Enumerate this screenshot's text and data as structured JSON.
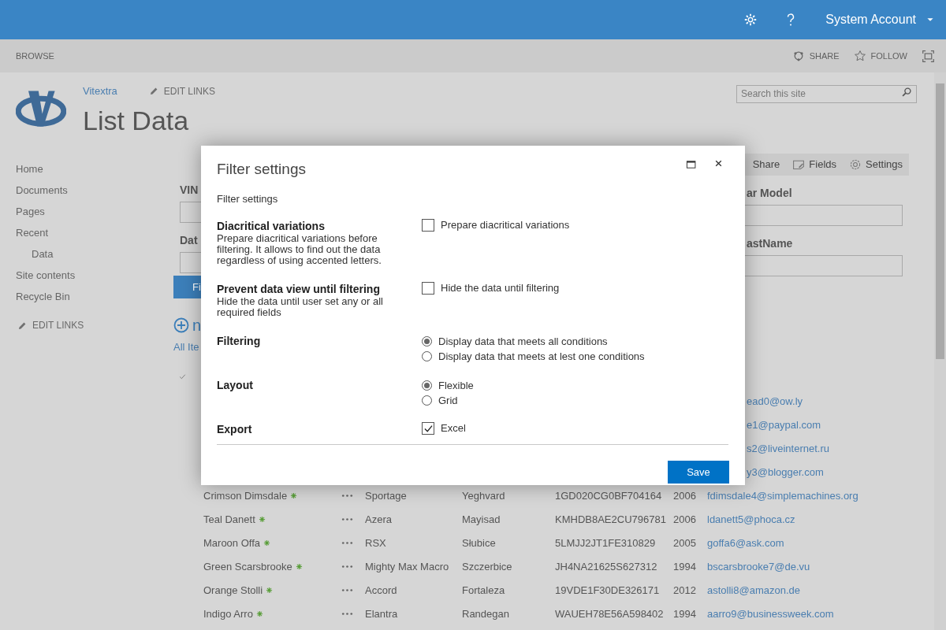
{
  "top_bar": {
    "user": "System Account"
  },
  "ribbon": {
    "tab": "BROWSE",
    "actions": [
      {
        "kind": "share",
        "label": "SHARE"
      },
      {
        "kind": "follow",
        "label": "FOLLOW"
      }
    ]
  },
  "site": {
    "name": "Vitextra",
    "edit_links": "EDIT LINKS",
    "title": "List Data",
    "search": {
      "placeholder": "Search this site"
    }
  },
  "nav": {
    "items": [
      {
        "label": "Home"
      },
      {
        "label": "Documents"
      },
      {
        "label": "Pages"
      },
      {
        "label": "Recent",
        "children": [
          {
            "label": "Data"
          }
        ]
      },
      {
        "label": "Site contents"
      },
      {
        "label": "Recycle Bin"
      }
    ],
    "edit_links": "EDIT LINKS"
  },
  "toolbar": [
    {
      "kind": "share",
      "label": "Share"
    },
    {
      "kind": "fields",
      "label": "Fields"
    },
    {
      "kind": "settings",
      "label": "Settings"
    }
  ],
  "filter_form": {
    "left_fields": [
      {
        "label": "VIN"
      },
      {
        "label": "Dat"
      }
    ],
    "right_fields": [
      {
        "label": "ar Model"
      },
      {
        "label": "astName"
      }
    ],
    "button": "Fi"
  },
  "list": {
    "new_label": "n",
    "view": "All Ite",
    "rows": [
      {
        "kind": "covered",
        "email": "ead0@ow.ly"
      },
      {
        "kind": "covered",
        "email": "e1@paypal.com"
      },
      {
        "kind": "covered",
        "email": "s2@liveinternet.ru"
      },
      {
        "kind": "covered",
        "email": "y3@blogger.com"
      },
      {
        "kind": "full",
        "name": "Crimson Dimsdale",
        "model": "Sportage",
        "city": "Yeghvard",
        "vin": "1GD020CG0BF704164",
        "year": "2006",
        "email": "fdimsdale4@simplemachines.org"
      },
      {
        "kind": "full",
        "name": "Teal Danett",
        "model": "Azera",
        "city": "Mayisad",
        "vin": "KMHDB8AE2CU796781",
        "year": "2006",
        "email": "ldanett5@phoca.cz"
      },
      {
        "kind": "full",
        "name": "Maroon Offa",
        "model": "RSX",
        "city": "Słubice",
        "vin": "5LMJJ2JT1FE310829",
        "year": "2005",
        "email": "goffa6@ask.com"
      },
      {
        "kind": "full",
        "name": "Green Scarsbrooke",
        "model": "Mighty Max Macro",
        "city": "Szczerbice",
        "vin": "JH4NA21625S627312",
        "year": "1994",
        "email": "bscarsbrooke7@de.vu"
      },
      {
        "kind": "full",
        "name": "Orange Stolli",
        "model": "Accord",
        "city": "Fortaleza",
        "vin": "19VDE1F30DE326171",
        "year": "2012",
        "email": "astolli8@amazon.de"
      },
      {
        "kind": "full",
        "name": "Indigo Arro",
        "model": "Elantra",
        "city": "Randegan",
        "vin": "WAUEH78E56A598402",
        "year": "1994",
        "email": "aarro9@businessweek.com"
      }
    ]
  },
  "dialog": {
    "title": "Filter settings",
    "subtitle": "Filter settings",
    "sections": [
      {
        "kind": "checkbox",
        "heading": "Diacritical variations",
        "description": "Prepare diacritical variations before filtering. It allows to find out the data regardless of using accented letters.",
        "options": [
          {
            "label": "Prepare diacritical variations",
            "checked": false
          }
        ]
      },
      {
        "kind": "checkbox",
        "heading": "Prevent data view until filtering",
        "description": "Hide the data until user set any or all required fields",
        "options": [
          {
            "label": "Hide the data until filtering",
            "checked": false
          }
        ]
      },
      {
        "kind": "radio",
        "heading": "Filtering",
        "options": [
          {
            "label": "Display data that meets all conditions",
            "selected": true
          },
          {
            "label": "Display data that meets at lest one conditions",
            "selected": false
          }
        ]
      },
      {
        "kind": "radio",
        "heading": "Layout",
        "options": [
          {
            "label": "Flexible",
            "selected": true
          },
          {
            "label": "Grid",
            "selected": false
          }
        ]
      },
      {
        "kind": "checkbox",
        "heading": "Export",
        "options": [
          {
            "label": "Excel",
            "checked": true
          }
        ]
      }
    ],
    "save": "Save"
  }
}
